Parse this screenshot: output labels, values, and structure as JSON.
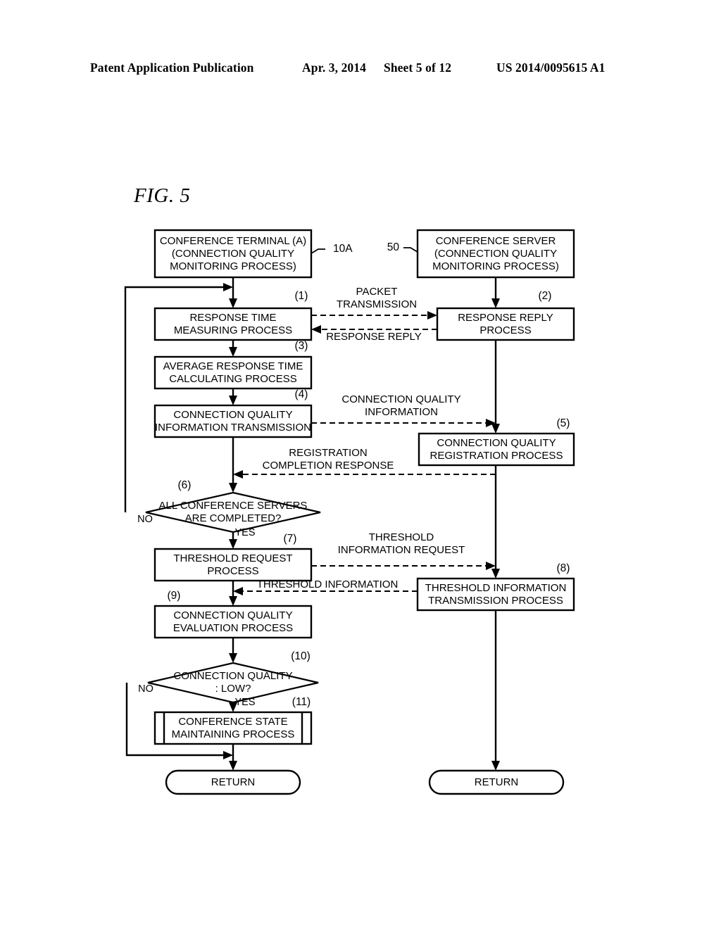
{
  "header": {
    "publication": "Patent Application Publication",
    "date": "Apr. 3, 2014",
    "sheet": "Sheet 5 of 12",
    "patent_number": "US 2014/0095615 A1"
  },
  "figure": {
    "label": "FIG. 5"
  },
  "diagram": {
    "type": "flowchart",
    "lanes": [
      {
        "id": "terminal",
        "ref": "10A",
        "title_line1": "CONFERENCE TERMINAL (A)",
        "title_line2": "(CONNECTION QUALITY",
        "title_line3": "MONITORING PROCESS)"
      },
      {
        "id": "server",
        "ref": "50",
        "title_line1": "CONFERENCE SERVER",
        "title_line2": "(CONNECTION QUALITY",
        "title_line3": "MONITORING PROCESS)"
      }
    ],
    "steps": [
      {
        "num": "(1)",
        "line1": "RESPONSE TIME",
        "line2": "MEASURING PROCESS",
        "lane": "terminal",
        "shape": "process"
      },
      {
        "num": "(2)",
        "line1": "RESPONSE REPLY",
        "line2": "PROCESS",
        "lane": "server",
        "shape": "process"
      },
      {
        "num": "(3)",
        "line1": "AVERAGE RESPONSE TIME",
        "line2": "CALCULATING PROCESS",
        "lane": "terminal",
        "shape": "process"
      },
      {
        "num": "(4)",
        "line1": "CONNECTION QUALITY",
        "line2": "INFORMATION TRANSMISSION",
        "lane": "terminal",
        "shape": "process"
      },
      {
        "num": "(5)",
        "line1": "CONNECTION QUALITY",
        "line2": "REGISTRATION PROCESS",
        "lane": "server",
        "shape": "process"
      },
      {
        "num": "(6)",
        "line1": "ALL CONFERENCE SERVERS",
        "line2": "ARE COMPLETED?",
        "lane": "terminal",
        "shape": "decision",
        "yes": "YES",
        "no": "NO"
      },
      {
        "num": "(7)",
        "line1": "THRESHOLD REQUEST",
        "line2": "PROCESS",
        "lane": "terminal",
        "shape": "process"
      },
      {
        "num": "(8)",
        "line1": "THRESHOLD INFORMATION",
        "line2": "TRANSMISSION PROCESS",
        "lane": "server",
        "shape": "process"
      },
      {
        "num": "(9)",
        "line1": "CONNECTION QUALITY",
        "line2": "EVALUATION PROCESS",
        "lane": "terminal",
        "shape": "process"
      },
      {
        "num": "(10)",
        "line1": "CONNECTION QUALITY",
        "line2": ": LOW?",
        "lane": "terminal",
        "shape": "decision",
        "yes": "YES",
        "no": "NO"
      },
      {
        "num": "(11)",
        "line1": "CONFERENCE STATE",
        "line2": "MAINTAINING PROCESS",
        "lane": "terminal",
        "shape": "predefined"
      }
    ],
    "messages": [
      {
        "id": "packet-transmission",
        "line1": "PACKET",
        "line2": "TRANSMISSION",
        "direction": "terminal-to-server"
      },
      {
        "id": "response-reply",
        "line1": "RESPONSE REPLY",
        "line2": "",
        "direction": "server-to-terminal"
      },
      {
        "id": "connection-quality-information",
        "line1": "CONNECTION QUALITY",
        "line2": "INFORMATION",
        "direction": "terminal-to-server"
      },
      {
        "id": "registration-completion-response",
        "line1": "REGISTRATION",
        "line2": "COMPLETION RESPONSE",
        "direction": "server-to-terminal"
      },
      {
        "id": "threshold-information-request",
        "line1": "THRESHOLD",
        "line2": "INFORMATION REQUEST",
        "direction": "terminal-to-server"
      },
      {
        "id": "threshold-information",
        "line1": "THRESHOLD INFORMATION",
        "line2": "",
        "direction": "server-to-terminal"
      }
    ],
    "terminators": [
      {
        "id": "return-terminal",
        "label": "RETURN",
        "lane": "terminal"
      },
      {
        "id": "return-server",
        "label": "RETURN",
        "lane": "server"
      }
    ]
  }
}
